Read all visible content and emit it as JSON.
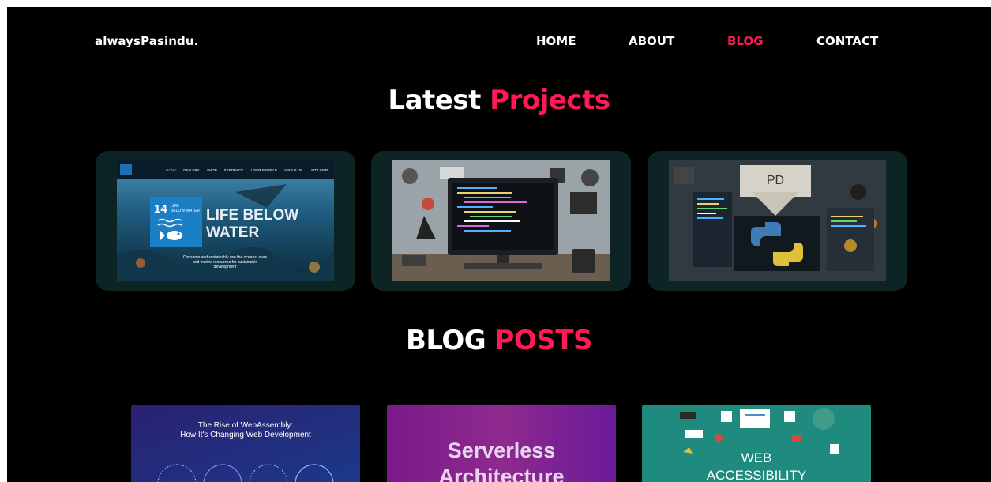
{
  "header": {
    "brand": "alwaysPasindu.",
    "nav": [
      {
        "label": "HOME",
        "active": false
      },
      {
        "label": "ABOUT",
        "active": false
      },
      {
        "label": "BLOG",
        "active": true
      },
      {
        "label": "CONTACT",
        "active": false
      }
    ]
  },
  "colors": {
    "background": "#000000",
    "accent": "#ff1a55",
    "card": "#0c2424",
    "text": "#ffffff"
  },
  "projects": {
    "title_part1": "Latest",
    "title_part2": "Projects",
    "items": [
      {
        "nav_items": [
          "HOME",
          "GALLERY",
          "SHOP",
          "FEEDBACK",
          "USER PROFILE",
          "ABOUT US",
          "SITE MAP"
        ],
        "badge_number": "14",
        "badge_text_line1": "LIFE",
        "badge_text_line2": "BELOW WATER",
        "headline_line1": "LIFE BELOW",
        "headline_line2": "WATER",
        "caption_line1": "Conserve and sustainably use the oceans, seas",
        "caption_line2": "and marine resources for sustainable",
        "caption_line3": "development"
      },
      {
        "illustration": "coding-desk-illustration"
      },
      {
        "document_label": "PD",
        "illustration": "python-logo-illustration"
      }
    ]
  },
  "blog": {
    "title_part1": "BLOG",
    "title_part2": "POSTS",
    "items": [
      {
        "title_line1": "The Rise of WebAssembly:",
        "title_line2": "How It's Changing Web Development"
      },
      {
        "title_line1": "Serverless",
        "title_line2": "Architecture"
      },
      {
        "title_line1": "WEB",
        "title_line2": "ACCESSIBILITY"
      }
    ]
  }
}
